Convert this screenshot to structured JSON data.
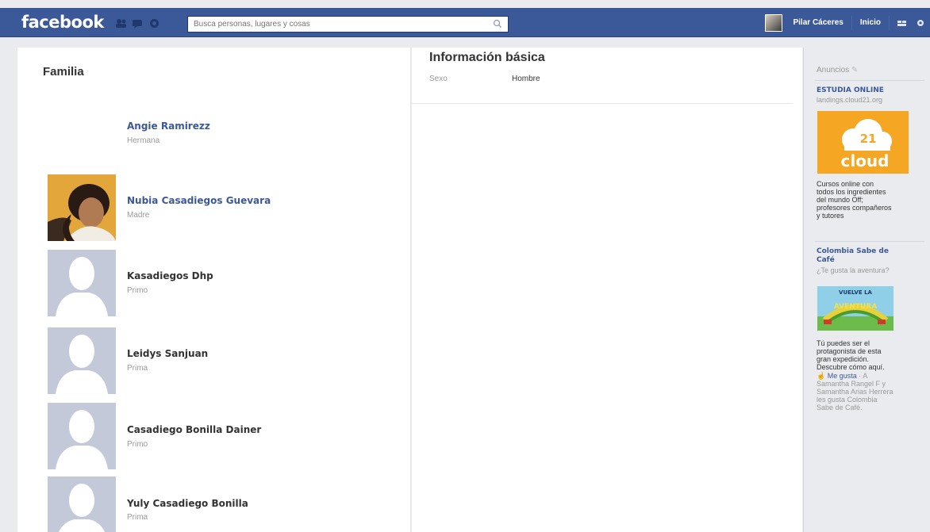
{
  "header": {
    "logo": "facebook",
    "search_placeholder": "Busca personas, lugares y cosas",
    "user_name": "Pilar Cáceres",
    "home_label": "Inicio"
  },
  "family": {
    "title": "Familia",
    "members": [
      {
        "name": "Angie Ramirezz",
        "relation": "Hermana"
      },
      {
        "name": "Nubia Casadiegos Guevara",
        "relation": "Madre"
      },
      {
        "name": "Kasadiegos Dhp",
        "relation": "Primo"
      },
      {
        "name": "Leidys Sanjuan",
        "relation": "Prima"
      },
      {
        "name": "Casadiego Bonilla Dainer",
        "relation": "Primo"
      },
      {
        "name": "Yuly Casadiego Bonilla",
        "relation": "Prima"
      }
    ]
  },
  "basic_info": {
    "title": "Información básica",
    "sex_label": "Sexo",
    "sex_value": "Hombre"
  },
  "ads": {
    "title": "Anuncios",
    "ad1": {
      "title": "ESTUDIA ONLINE",
      "url": "landings.cloud21.org",
      "image_text_top": "21",
      "image_text_bottom": "cloud",
      "text_lines": [
        "Cursos online con",
        "todos los ingredientes",
        "del mundo Off;",
        "profesores compañeros",
        "y tutores"
      ]
    },
    "ad2": {
      "title_line1": "Colombia Sabe de",
      "title_line2": "Café",
      "subtitle": "¿Te gusta la aventura?",
      "image_text_top": "VUELVE LA",
      "image_text_bottom": "AVENTURA",
      "text_lines": [
        "Tú puedes ser el",
        "protagonista de esta",
        "gran expedición.",
        "Descubre cómo aquí."
      ],
      "like_label": "Me gusta",
      "social_lines": [
        " · A",
        "Samantha Rangel F y",
        "Samantha Arias Herrera",
        "les gusta Colombia",
        "Sabe de Café."
      ]
    }
  },
  "colors": {
    "brand_blue": "#3b5998",
    "ad1_orange": "#f5a623",
    "link_blue": "#3b5998"
  }
}
